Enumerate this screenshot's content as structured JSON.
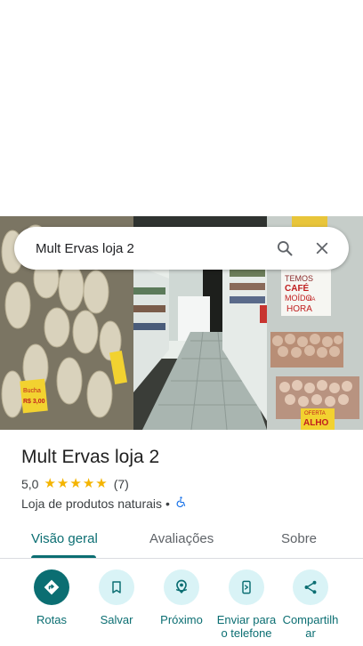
{
  "search": {
    "query": "Mult Ervas loja 2"
  },
  "place": {
    "name": "Mult Ervas loja 2",
    "rating_value": "5,0",
    "stars": 5,
    "review_count": "(7)",
    "category": "Loja de produtos naturais",
    "separator": "•",
    "accessibility_icon": "wheelchair-icon"
  },
  "photo_signs": {
    "price_left": "Bucha",
    "price_left_amount": "R$ 3,00",
    "sign_right_1": "TEMOS",
    "sign_right_2": "CAFÉ",
    "sign_right_3": "MOÍDO",
    "sign_right_4": "NA",
    "sign_right_5": "HORA",
    "oferta": "OFERTA",
    "alho": "ALHO"
  },
  "tabs": [
    {
      "label": "Visão geral",
      "active": true
    },
    {
      "label": "Avaliações",
      "active": false
    },
    {
      "label": "Sobre",
      "active": false
    }
  ],
  "actions": [
    {
      "label": "Rotas",
      "icon": "directions-icon"
    },
    {
      "label": "Salvar",
      "icon": "bookmark-icon"
    },
    {
      "label": "Próximo",
      "icon": "nearby-icon"
    },
    {
      "label": "Enviar para o telefone",
      "icon": "send-to-phone-icon"
    },
    {
      "label": "Compartilhar",
      "icon": "share-icon"
    }
  ],
  "colors": {
    "accent": "#0b6e72",
    "accent_light": "#d9f3f6",
    "star": "#f4b400"
  }
}
